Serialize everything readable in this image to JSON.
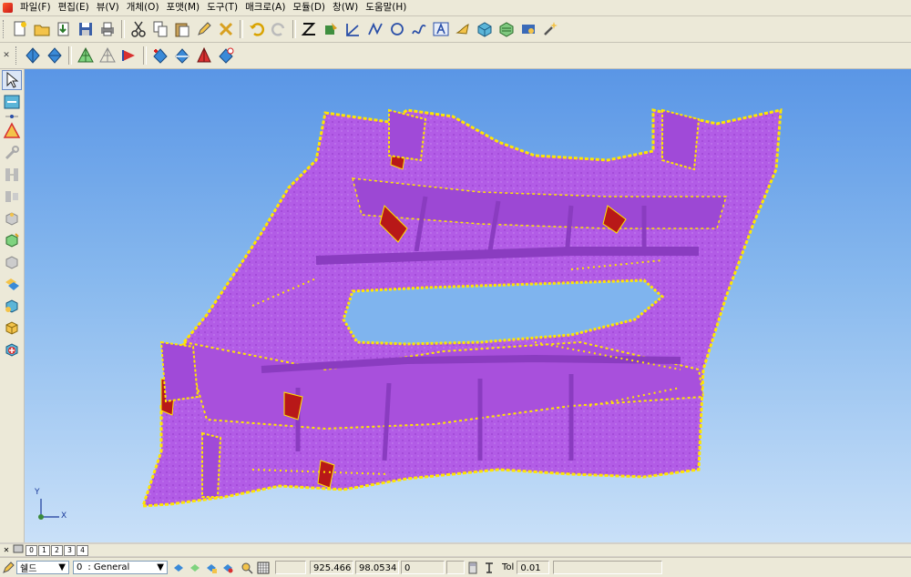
{
  "menu": {
    "items": [
      "파일(F)",
      "편집(E)",
      "뷰(V)",
      "개체(O)",
      "포맷(M)",
      "도구(T)",
      "매크로(A)",
      "모듈(D)",
      "창(W)",
      "도움말(H)"
    ]
  },
  "toolbar1": {
    "icons": [
      "new-file-icon",
      "open-folder-icon",
      "import-icon",
      "save-icon",
      "print-icon",
      "cut-icon",
      "copy-icon",
      "paste-icon",
      "edit-pen-icon",
      "delete-icon",
      "undo-icon",
      "redo-icon",
      "sketch-icon",
      "paint-icon",
      "line-icon",
      "polyline-icon",
      "circle-icon",
      "curve-icon",
      "text-icon",
      "point-icon",
      "solid-icon",
      "surface-icon",
      "mesh-icon",
      "magic-icon"
    ]
  },
  "toolbar2": {
    "icons": [
      "view-front-icon",
      "view-side-icon",
      "mesh-view-icon",
      "wire-view-icon",
      "shade-view-icon",
      "section-icon",
      "clip-icon",
      "pyramid-icon",
      "arrow-view-icon",
      "zoom-view-icon"
    ]
  },
  "left_toolbar": {
    "icons": [
      "select-arrow-icon",
      "transform-icon",
      "measure-icon",
      "wrench-icon",
      "align-icon",
      "mirror-icon",
      "cube-tool-icon",
      "offset-icon",
      "shell-icon",
      "shape-icon",
      "solid-box-icon",
      "add-solid-icon"
    ]
  },
  "viewport": {
    "axis_x": "X",
    "axis_y": "Y",
    "model_color": "#b25ce6",
    "edge_color": "#ffe600"
  },
  "page_tabs": [
    "0",
    "1",
    "2",
    "3",
    "4"
  ],
  "status": {
    "layer_name": "쉘드",
    "layer_index": "0",
    "layer_group": ": General",
    "coord_x": "925.466",
    "coord_y": "98.0534",
    "coord_z": "0",
    "tol_label": "Tol",
    "tol_value": "0.01"
  }
}
